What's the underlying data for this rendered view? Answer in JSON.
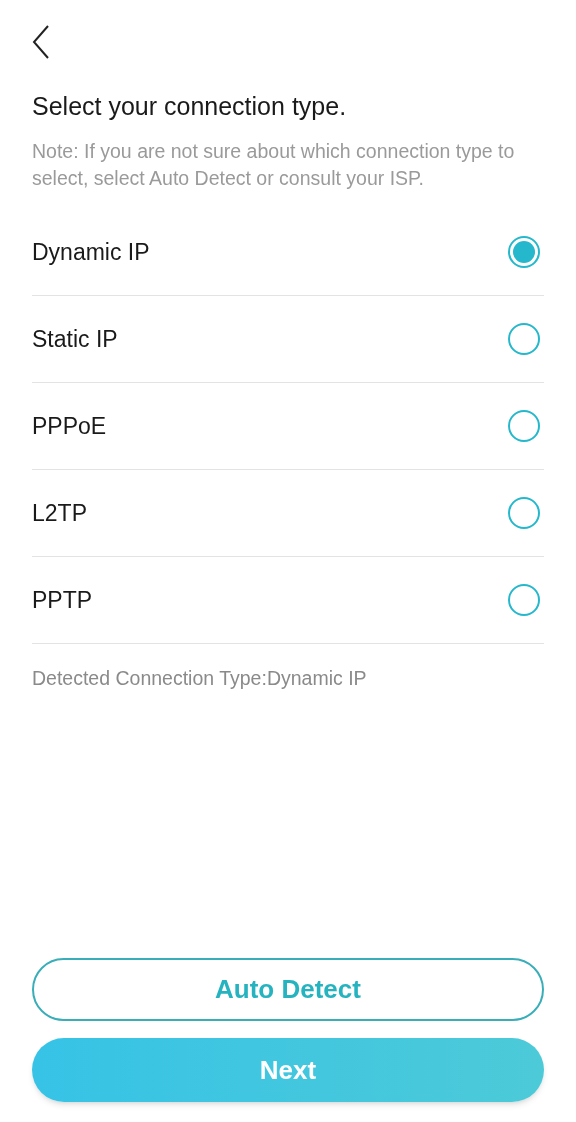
{
  "title": "Select your connection type.",
  "note": "Note: If you are not sure about which connection type to select, select Auto Detect or consult your ISP.",
  "options": [
    {
      "label": "Dynamic IP",
      "selected": true
    },
    {
      "label": "Static IP",
      "selected": false
    },
    {
      "label": "PPPoE",
      "selected": false
    },
    {
      "label": "L2TP",
      "selected": false
    },
    {
      "label": "PPTP",
      "selected": false
    }
  ],
  "detected": "Detected Connection Type:Dynamic IP",
  "buttons": [
    {
      "label": "Auto Detect",
      "kind": "outline"
    },
    {
      "label": "Next",
      "kind": "primary"
    }
  ]
}
